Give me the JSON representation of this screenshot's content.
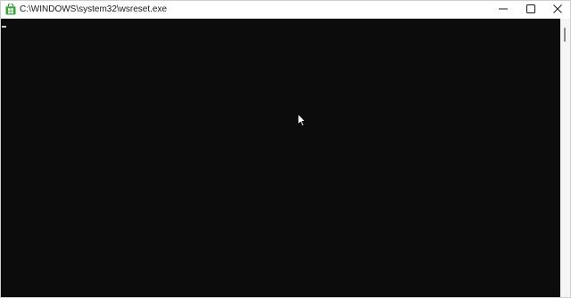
{
  "window": {
    "title": "C:\\WINDOWS\\system32\\wsreset.exe",
    "app_icon": "store-app-icon",
    "controls": {
      "minimize_icon": "minimize-icon",
      "maximize_icon": "maximize-icon",
      "close_icon": "close-icon"
    }
  },
  "console": {
    "background": "#0c0c0c",
    "caret_color": "#cccccc",
    "output_text": ""
  },
  "scrollbar": {
    "thumb_color": "#8a8a8a"
  },
  "cursor": {
    "icon": "mouse-pointer-icon"
  }
}
